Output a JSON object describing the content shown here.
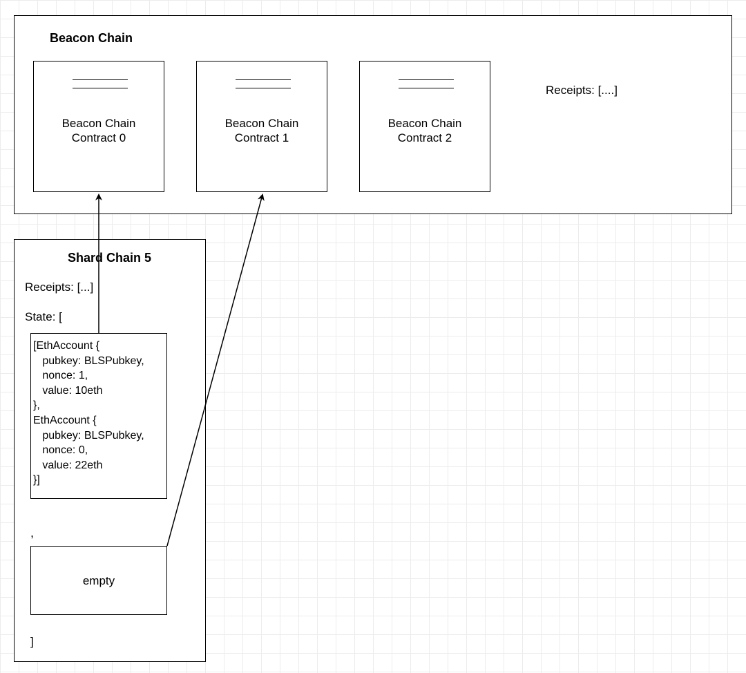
{
  "beacon": {
    "title": "Beacon Chain",
    "contracts": [
      {
        "line1": "Beacon Chain",
        "line2": "Contract 0"
      },
      {
        "line1": "Beacon Chain",
        "line2": "Contract 1"
      },
      {
        "line1": "Beacon Chain",
        "line2": "Contract 2"
      }
    ],
    "receipts_label": "Receipts: [....]"
  },
  "shard": {
    "title": "Shard Chain 5",
    "receipts_label": "Receipts: [...]",
    "state_label": "State:  [",
    "state_body": "[EthAccount {\n   pubkey: BLSPubkey,\n   nonce: 1,\n   value: 10eth\n},\nEthAccount {\n   pubkey: BLSPubkey,\n   nonce: 0,\n   value: 22eth\n}]",
    "comma": ",",
    "empty_label": "empty",
    "close_bracket": "]"
  }
}
